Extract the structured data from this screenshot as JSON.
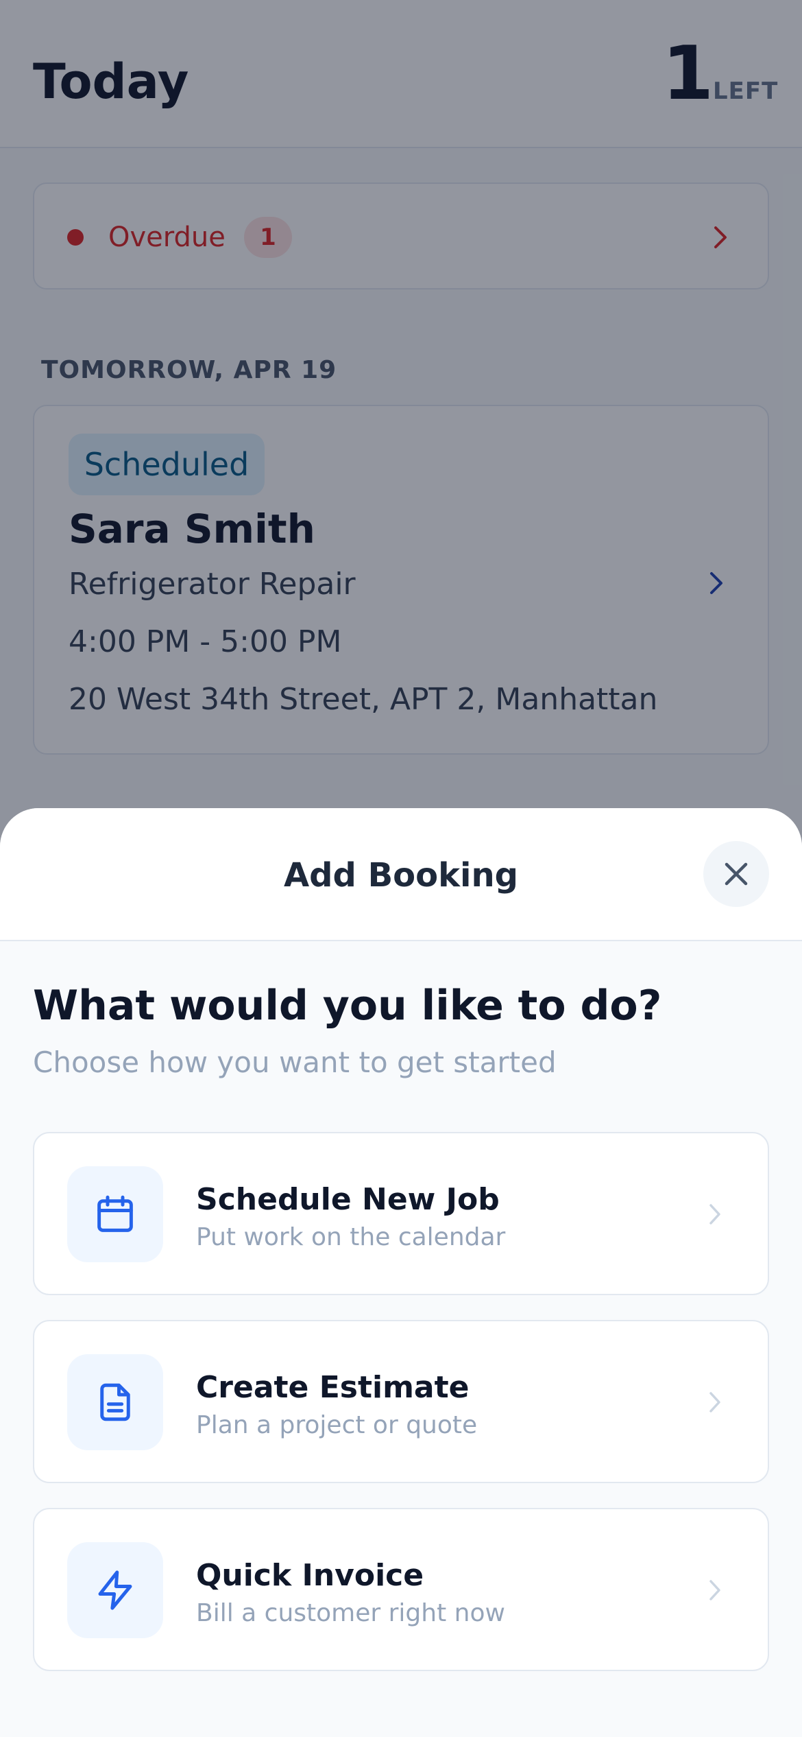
{
  "colors": {
    "primary": "#2563eb",
    "danger": "#dc2626",
    "text_dark": "#0f172a",
    "text_muted": "#94a3b8",
    "status_scheduled_bg": "#e0f2fe",
    "status_scheduled_text": "#075985"
  },
  "header": {
    "title": "Today",
    "remaining_count": "1",
    "remaining_label": "LEFT"
  },
  "overdue": {
    "label": "Overdue",
    "count": "1",
    "icon": "chevron-right-icon"
  },
  "schedule": {
    "section_label": "TOMORROW, APR 19",
    "jobs": [
      {
        "status": "Scheduled",
        "customer": "Sara Smith",
        "service": "Refrigerator Repair",
        "time": "4:00 PM - 5:00 PM",
        "address": "20 West 34th Street, APT 2, Manhattan"
      }
    ]
  },
  "sheet": {
    "title": "Add Booking",
    "close_icon": "close-icon",
    "heading": "What would you like to do?",
    "subheading": "Choose how you want to get started",
    "options": [
      {
        "icon": "calendar-icon",
        "title": "Schedule New Job",
        "description": "Put work on the calendar"
      },
      {
        "icon": "document-icon",
        "title": "Create Estimate",
        "description": "Plan a project or quote"
      },
      {
        "icon": "lightning-icon",
        "title": "Quick Invoice",
        "description": "Bill a customer right now"
      }
    ]
  }
}
